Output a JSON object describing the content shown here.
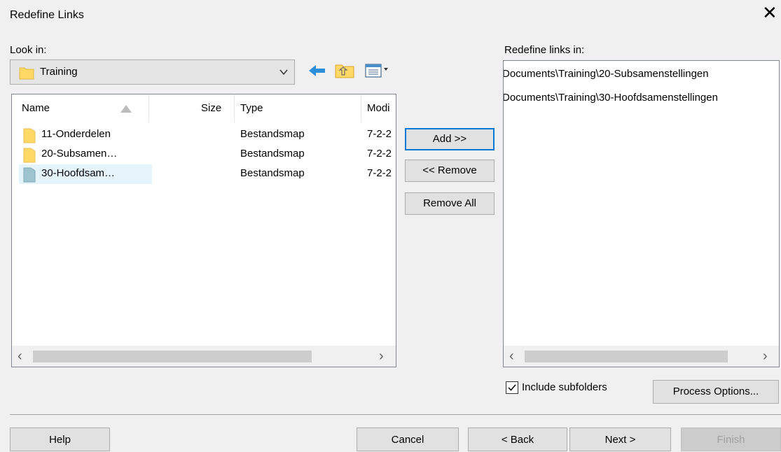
{
  "window": {
    "title": "Redefine Links"
  },
  "icons": [
    "close-icon",
    "folder-icon",
    "chevron-down-icon",
    "back-arrow-icon",
    "up-folder-icon",
    "view-menu-icon",
    "sort-ascending-icon",
    "scroll-left-icon",
    "scroll-right-icon",
    "checkmark-icon"
  ],
  "look_in": {
    "label": "Look in:",
    "selected": "Training"
  },
  "file_list": {
    "columns": [
      "Name",
      "Size",
      "Type",
      "Modi"
    ],
    "rows": [
      {
        "name": "11-Onderdelen",
        "size": "",
        "type": "Bestandsmap",
        "modified": "7-2-2"
      },
      {
        "name": "20-Subsamen…",
        "size": "",
        "type": "Bestandsmap",
        "modified": "7-2-2"
      },
      {
        "name": "30-Hoofdsam…",
        "size": "",
        "type": "Bestandsmap",
        "modified": "7-2-2"
      }
    ]
  },
  "actions": {
    "add": "Add >>",
    "remove": "<< Remove",
    "remove_all": "Remove All"
  },
  "redefine": {
    "label": "Redefine links in:",
    "items": [
      "Documents\\Training\\20-Subsamenstellingen",
      "Documents\\Training\\30-Hoofdsamenstellingen"
    ]
  },
  "include_subfolders": {
    "label": "Include subfolders",
    "checked": true
  },
  "process_options": "Process Options...",
  "footer": {
    "help": "Help",
    "cancel": "Cancel",
    "back": "< Back",
    "next": "Next >",
    "finish": "Finish"
  },
  "colors": {
    "accent": "#0078d7",
    "folder": "#ffd866",
    "selected_folder": "#9dc4cf",
    "arrow_blue": "#2b8fd9"
  }
}
